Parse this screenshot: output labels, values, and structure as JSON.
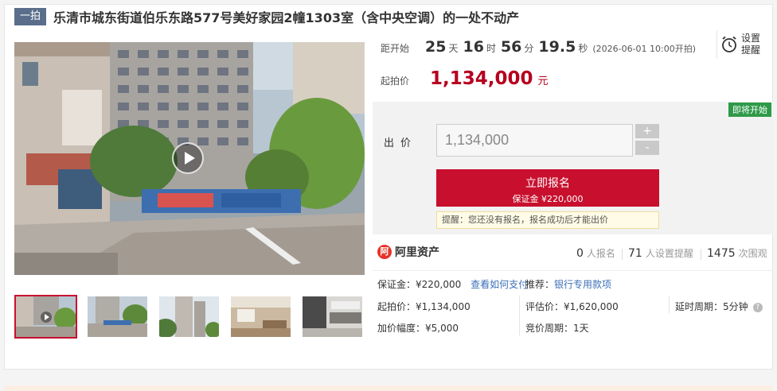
{
  "title": {
    "tag": "一拍",
    "text": "乐清市城东街道伯乐东路577号美好家园2幢1303室（含中央空调）的一处不动产"
  },
  "countdown": {
    "label": "距开始",
    "days": "25",
    "days_unit": "天",
    "hours": "16",
    "hours_unit": "时",
    "minutes": "56",
    "minutes_unit": "分",
    "seconds": "19.5",
    "seconds_unit": "秒",
    "start_text": "(2026-06-01 10:00开拍)"
  },
  "reminder": {
    "line1": "设置",
    "line2": "提醒",
    "icon": "alarm-clock-icon"
  },
  "start_price": {
    "label": "起拍价",
    "value": "1,134,000",
    "unit": "元"
  },
  "bid": {
    "badge": "即将开始",
    "label": "出价",
    "input_value": "1,134,000",
    "plus": "+",
    "minus": "-",
    "apply_label": "立即报名",
    "deposit_label": "保证金 ¥220,000",
    "notice": "提醒：您还没有报名，报名成功后才能出价"
  },
  "stats": {
    "brand": "阿里资产",
    "brand_mark": "阿",
    "signups": "0",
    "signups_label": "人报名",
    "reminders": "71",
    "reminders_label": "人设置提醒",
    "views": "1475",
    "views_label": "次围观"
  },
  "info": {
    "deposit": "保证金：¥220,000",
    "pay_link": "查看如何支付",
    "recommend_label": "推荐：",
    "recommend_link": "银行专用款项",
    "start_price": "起拍价：¥1,134,000",
    "appraisal": "评估价：¥1,620,000",
    "delay": "延时周期：5分钟",
    "increment": "加价幅度：¥5,000",
    "cycle": "竞价周期：1天"
  },
  "gallery": {
    "thumb_count": 5,
    "active_index": 0
  },
  "colors": {
    "accent": "#c8102e",
    "price": "#b6001f",
    "badge": "#2e9a49",
    "tag": "#5a6e8c",
    "link": "#3b6fb6"
  }
}
